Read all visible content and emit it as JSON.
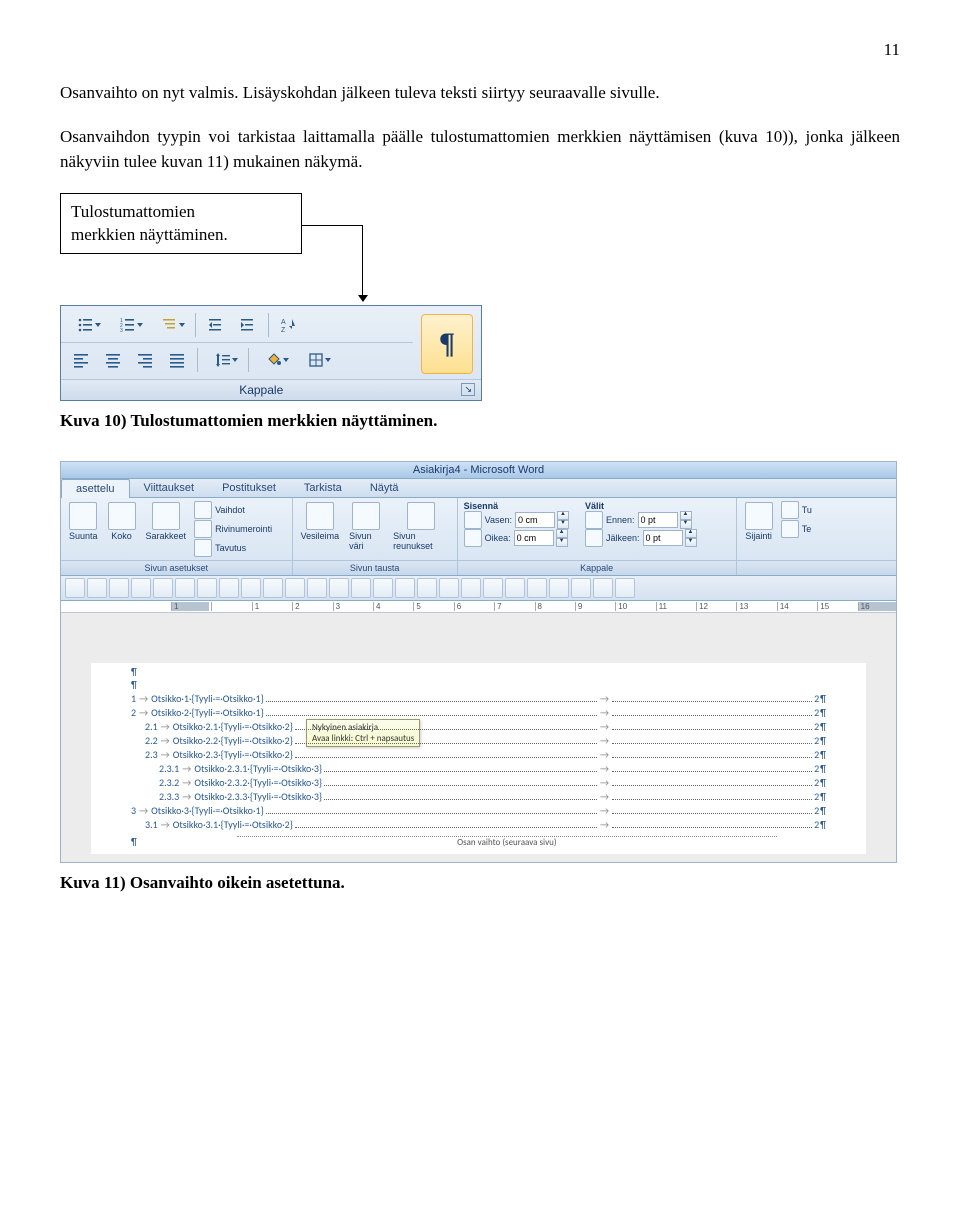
{
  "page_number": "11",
  "paragraphs": {
    "p1": "Osanvaihto on nyt valmis. Lisäyskohdan jälkeen tuleva teksti siirtyy seuraavalle sivulle.",
    "p2": "Osanvaihdon tyypin voi tarkistaa laittamalla päälle tulostumattomien merkkien näyttämisen (kuva 10)), jonka jälkeen näkyviin tulee kuvan 11) mukainen näkymä."
  },
  "callout": {
    "line1": "Tulostumattomien",
    "line2": "merkkien näyttäminen."
  },
  "fig1": {
    "group_label": "Kappale",
    "pilcrow": "¶"
  },
  "caption1": "Kuva 10) Tulostumattomien merkkien näyttäminen.",
  "fig2": {
    "title": "Asiakirja4 - Microsoft Word",
    "tabs": [
      "asettelu",
      "Viittaukset",
      "Postitukset",
      "Tarkista",
      "Näytä"
    ],
    "groups": {
      "sivun_asetukset": {
        "label": "Sivun asetukset",
        "items": [
          "Suunta",
          "Koko",
          "Sarakkeet"
        ],
        "small": [
          "Vaihdot",
          "Rivinumerointi",
          "Tavutus"
        ]
      },
      "sivun_tausta": {
        "label": "Sivun tausta",
        "items": [
          "Vesileima",
          "Sivun väri",
          "Sivun reunukset"
        ]
      },
      "kappale": {
        "label": "Kappale",
        "sisenna": "Sisennä",
        "valit": "Välit",
        "vasen_label": "Vasen:",
        "oikea_label": "Oikea:",
        "ennen_label": "Ennen:",
        "jalkeen_label": "Jälkeen:",
        "vasen_val": "0 cm",
        "oikea_val": "0 cm",
        "ennen_val": "0 pt",
        "jalkeen_val": "0 pt"
      },
      "jarjesta": {
        "label": "",
        "sijainti": "Sijainti",
        "tu": "Tu",
        "te": "Te"
      }
    },
    "ruler": [
      "1",
      "",
      "1",
      "2",
      "3",
      "4",
      "5",
      "6",
      "7",
      "8",
      "9",
      "10",
      "11",
      "12",
      "13",
      "14",
      "15",
      "16"
    ],
    "tooltip": {
      "title": "Nykyinen asiakirja",
      "line": "Avaa linkki: Ctrl + napsautus"
    },
    "toc": [
      {
        "ind": 0,
        "num": "1",
        "title": "Otsikko·1",
        "style": "{Tyyli·=·Otsikko·1}",
        "page": "2"
      },
      {
        "ind": 0,
        "num": "2",
        "title": "Otsikko·2",
        "style": "{Tyyli·=·Otsikko·1}",
        "page": "2"
      },
      {
        "ind": 1,
        "num": "2.1",
        "title": "Otsikko·2.1",
        "style": "{Tyyli·=·Otsikko·2}",
        "page": "2"
      },
      {
        "ind": 1,
        "num": "2.2",
        "title": "Otsikko·2.2",
        "style": "{Tyyli·=·Otsikko·2}",
        "page": "2"
      },
      {
        "ind": 1,
        "num": "2.3",
        "title": "Otsikko·2.3",
        "style": "{Tyyli·=·Otsikko·2}",
        "page": "2"
      },
      {
        "ind": 2,
        "num": "2.3.1",
        "title": "Otsikko·2.3.1",
        "style": "{Tyyli·=·Otsikko·3}",
        "page": "2"
      },
      {
        "ind": 2,
        "num": "2.3.2",
        "title": "Otsikko·2.3.2",
        "style": "{Tyyli·=·Otsikko·3}",
        "page": "2"
      },
      {
        "ind": 2,
        "num": "2.3.3",
        "title": "Otsikko·2.3.3",
        "style": "{Tyyli·=·Otsikko·3}",
        "page": "2"
      },
      {
        "ind": 0,
        "num": "3",
        "title": "Otsikko·3",
        "style": "{Tyyli·=·Otsikko·1}",
        "page": "2"
      },
      {
        "ind": 1,
        "num": "3.1",
        "title": "Otsikko·3.1",
        "style": "{Tyyli·=·Otsikko·2}",
        "page": "2"
      }
    ],
    "section_break": "Osan vaihto (seuraava sivu)"
  },
  "caption2": "Kuva 11) Osanvaihto oikein asetettuna."
}
